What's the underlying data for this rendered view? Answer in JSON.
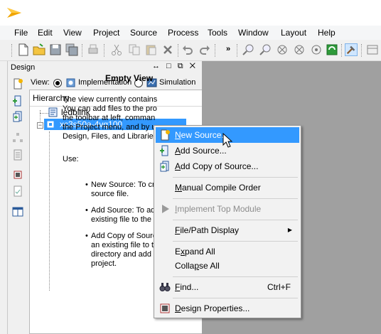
{
  "menubar": [
    "File",
    "Edit",
    "View",
    "Project",
    "Source",
    "Process",
    "Tools",
    "Window",
    "Layout",
    "Help"
  ],
  "toolbar": {
    "overflow": "»"
  },
  "design_panel": {
    "title": "Design",
    "controls": "↔ □ ⧉ ✕",
    "view_label": "View:",
    "view_options": [
      "Implementation",
      "Simulation"
    ],
    "selected_view": "Implementation"
  },
  "hierarchy": {
    "header": "Hierarchy",
    "items": [
      {
        "label": "ledblink",
        "selected": false
      },
      {
        "label": "xc3s50a-4vq100",
        "selected": true
      }
    ]
  },
  "empty_view": {
    "title": "Empty View",
    "paragraph": [
      "The view currently contains",
      "You can add files to the pro",
      "the toolbar at left, comman",
      "the Project menu, and by u",
      "Design, Files, and Libraries"
    ],
    "use_label": "Use:",
    "bullets": [
      {
        "lines": [
          "New Source: To cre",
          "source file."
        ]
      },
      {
        "lines": [
          "Add Source: To ad",
          "existing file to the"
        ]
      },
      {
        "lines": [
          "Add Copy of Sourc",
          "an existing file to t",
          "directory and add",
          "project."
        ]
      }
    ]
  },
  "context_menu": {
    "items": [
      {
        "label": "New Source...",
        "mnemonic": "N",
        "icon": "new-source-icon",
        "highlighted": true,
        "disabled": false,
        "shortcut": "",
        "submenu": false
      },
      {
        "label": "Add Source...",
        "mnemonic": "A",
        "icon": "add-source-icon",
        "highlighted": false,
        "disabled": false,
        "shortcut": "",
        "submenu": false
      },
      {
        "label": "Add Copy of Source...",
        "mnemonic": "d",
        "icon": "add-copy-source-icon",
        "highlighted": false,
        "disabled": false,
        "shortcut": "",
        "submenu": false
      },
      {
        "label": "Manual Compile Order",
        "mnemonic": "M",
        "icon": "",
        "highlighted": false,
        "disabled": false,
        "shortcut": "",
        "submenu": false
      },
      {
        "label": "Implement Top Module",
        "mnemonic": "I",
        "icon": "play-icon",
        "highlighted": false,
        "disabled": true,
        "shortcut": "",
        "submenu": false
      },
      {
        "label": "File/Path Display",
        "mnemonic": "F",
        "icon": "",
        "highlighted": false,
        "disabled": false,
        "shortcut": "",
        "submenu": true
      },
      {
        "label": "Expand All",
        "mnemonic": "x",
        "icon": "",
        "highlighted": false,
        "disabled": false,
        "shortcut": "",
        "submenu": false
      },
      {
        "label": "Collapse All",
        "mnemonic": "s",
        "icon": "",
        "highlighted": false,
        "disabled": false,
        "shortcut": "",
        "submenu": false
      },
      {
        "label": "Find...",
        "mnemonic": "F",
        "icon": "binoculars-icon",
        "highlighted": false,
        "disabled": false,
        "shortcut": "Ctrl+F",
        "submenu": false
      },
      {
        "label": "Design Properties...",
        "mnemonic": "D",
        "icon": "design-properties-icon",
        "highlighted": false,
        "disabled": false,
        "shortcut": "",
        "submenu": false
      }
    ]
  },
  "colors": {
    "selection": "#3399ff",
    "workspace": "#a0a0a0",
    "menu_bg": "#f2f2f2"
  }
}
